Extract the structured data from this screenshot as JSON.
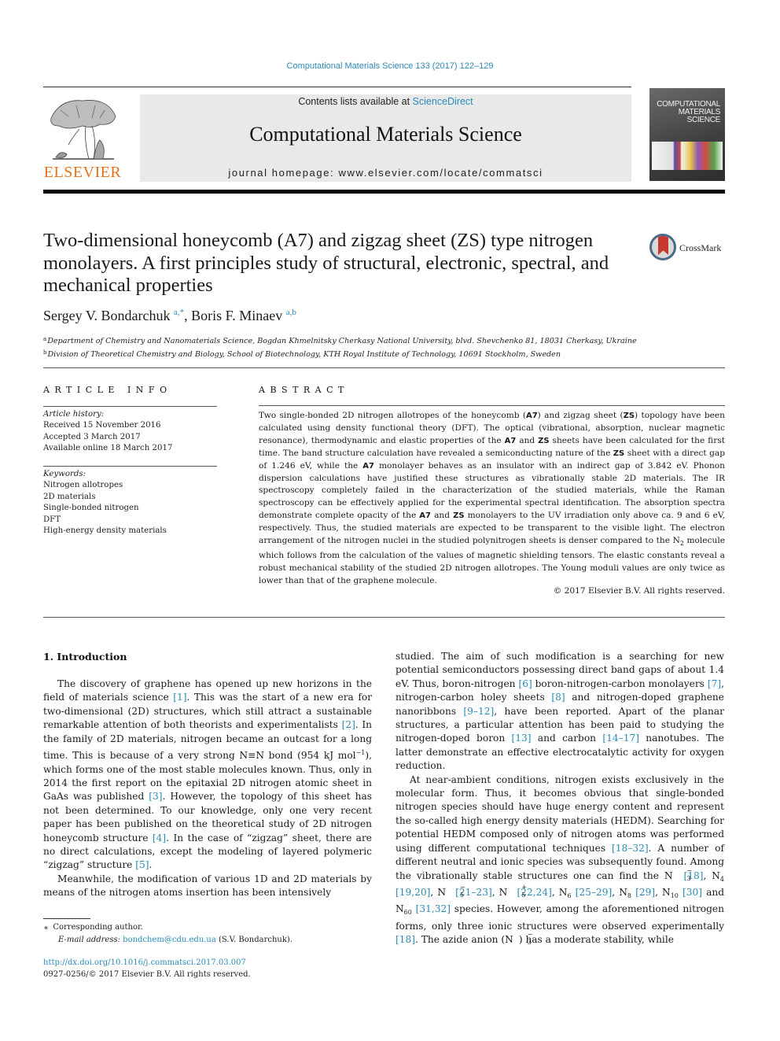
{
  "journal_citation": "Computational Materials Science 133 (2017) 122–129",
  "publisher": {
    "logo_wordmark": "ELSEVIER",
    "logo_icon": "elsevier-tree-icon"
  },
  "banner": {
    "contents_prefix": "Contents lists available at ",
    "contents_link": "ScienceDirect",
    "journal_title": "Computational Materials Science",
    "homepage_label": "journal homepage: ",
    "homepage_url": "www.elsevier.com/locate/commatsci"
  },
  "cover": {
    "title_lines": [
      "COMPUTATIONAL",
      "MATERIALS",
      "SCIENCE"
    ]
  },
  "colors": {
    "link": "#2a8ab8",
    "elsevier_orange": "#e8731a",
    "banner_bg": "#e9e9e9",
    "crossmark_red": "#c8372d"
  },
  "article": {
    "title": "Two-dimensional honeycomb (A7) and zigzag sheet (ZS) type nitrogen monolayers. A first principles study of structural, electronic, spectral, and mechanical properties",
    "crossmark_label": "CrossMark",
    "authors": [
      {
        "name": "Sergey V. Bondarchuk",
        "affil": "a,*"
      },
      {
        "name": "Boris F. Minaev",
        "affil": "a,b"
      }
    ],
    "author_separator": ", ",
    "affiliations": [
      {
        "mark": "a",
        "text": "Department of Chemistry and Nanomaterials Science, Bogdan Khmelnitsky Cherkasy National University, blvd. Shevchenko 81, 18031 Cherkasy, Ukraine"
      },
      {
        "mark": "b",
        "text": "Division of Theoretical Chemistry and Biology, School of Biotechnology, KTH Royal Institute of Technology, 10691 Stockholm, Sweden"
      }
    ]
  },
  "article_info": {
    "heading": "ARTICLE INFO",
    "history_label": "Article history:",
    "history": [
      "Received 15 November 2016",
      "Accepted 3 March 2017",
      "Available online 18 March 2017"
    ],
    "keywords_label": "Keywords:",
    "keywords": [
      "Nitrogen allotropes",
      "2D materials",
      "Single-bonded nitrogen",
      "DFT",
      "High-energy density materials"
    ]
  },
  "abstract": {
    "heading": "ABSTRACT",
    "segments": [
      {
        "t": "Two single-bonded 2D nitrogen allotropes of the honeycomb ("
      },
      {
        "t": "A7",
        "b": true
      },
      {
        "t": ") and zigzag sheet ("
      },
      {
        "t": "ZS",
        "b": true
      },
      {
        "t": ") topology have been calculated using density functional theory (DFT). The optical (vibrational, absorption, nuclear magnetic resonance), thermodynamic and elastic properties of the "
      },
      {
        "t": "A7",
        "b": true
      },
      {
        "t": " and "
      },
      {
        "t": "ZS",
        "b": true
      },
      {
        "t": " sheets have been calculated for the first time. The band structure calculation have revealed a semiconducting nature of the "
      },
      {
        "t": "ZS",
        "b": true
      },
      {
        "t": " sheet with a direct gap of 1.246 eV, while the "
      },
      {
        "t": "A7",
        "b": true
      },
      {
        "t": " monolayer behaves as an insulator with an indirect gap of 3.842 eV. Phonon dispersion calculations have justified these structures as vibrationally stable 2D materials. The IR spectroscopy completely failed in the characterization of the studied materials, while the Raman spectroscopy can be effectively applied for the experimental spectral identification. The absorption spectra demonstrate complete opacity of the "
      },
      {
        "t": "A7",
        "b": true
      },
      {
        "t": " and "
      },
      {
        "t": "ZS",
        "b": true
      },
      {
        "t": " monolayers to the UV irradiation only above ca. 9 and 6 eV, respectively. Thus, the studied materials are expected to be transparent to the visible light. The electron arrangement of the nitrogen nuclei in the studied polynitrogen sheets is denser compared to the N"
      },
      {
        "t": "2",
        "sub": true
      },
      {
        "t": " molecule which follows from the calculation of the values of magnetic shielding tensors. The elastic constants reveal a robust mechanical stability of the studied 2D nitrogen allotropes. The Young moduli values are only twice as lower than that of the graphene molecule."
      }
    ],
    "copyright": "© 2017 Elsevier B.V. All rights reserved."
  },
  "introduction": {
    "heading": "1. Introduction",
    "left_column": [
      [
        {
          "t": "The discovery of graphene has opened up new horizons in the field of materials science "
        },
        {
          "t": "[1]",
          "ref": true
        },
        {
          "t": ". This was the start of a new era for two-dimensional (2D) structures, which still attract a sustainable remarkable attention of both theorists and experimentalists "
        },
        {
          "t": "[2]",
          "ref": true
        },
        {
          "t": ". In the family of 2D materials, nitrogen became an outcast for a long time. This is because of a very strong N≡N bond (954 kJ mol"
        },
        {
          "t": "−1",
          "sup": true
        },
        {
          "t": "), which forms one of the most stable molecules known. Thus, only in 2014 the first report on the epitaxial 2D nitrogen atomic sheet in GaAs was published "
        },
        {
          "t": "[3]",
          "ref": true
        },
        {
          "t": ". However, the topology of this sheet has not been determined. To our knowledge, only one very recent paper has been published on the theoretical study of 2D nitrogen honeycomb structure "
        },
        {
          "t": "[4]",
          "ref": true
        },
        {
          "t": ". In the case of “zigzag” sheet, there are no direct calculations, except the modeling of layered polymeric “zigzag” structure "
        },
        {
          "t": "[5]",
          "ref": true
        },
        {
          "t": "."
        }
      ],
      [
        {
          "t": "Meanwhile, the modification of various 1D and 2D materials by means of the nitrogen atoms insertion has been intensively"
        }
      ]
    ],
    "right_column": [
      [
        {
          "t": "studied. The aim of such modification is a searching for new potential semiconductors possessing direct band gaps of about 1.4 eV. Thus, boron-nitrogen "
        },
        {
          "t": "[6]",
          "ref": true
        },
        {
          "t": " boron-nitrogen-carbon monolayers "
        },
        {
          "t": "[7]",
          "ref": true
        },
        {
          "t": ", nitrogen-carbon holey sheets "
        },
        {
          "t": "[8]",
          "ref": true
        },
        {
          "t": " and nitrogen-doped graphene nanoribbons "
        },
        {
          "t": "[9–12]",
          "ref": true
        },
        {
          "t": ", have been reported. Apart of the planar structures, a particular attention has been paid to studying the nitrogen-doped boron "
        },
        {
          "t": "[13]",
          "ref": true
        },
        {
          "t": " and carbon "
        },
        {
          "t": "[14–17]",
          "ref": true
        },
        {
          "t": " nanotubes. The latter demonstrate an effective electrocatalytic activity for oxygen reduction."
        }
      ],
      [
        {
          "t": "At near-ambient conditions, nitrogen exists exclusively in the molecular form. Thus, it becomes obvious that single-bonded nitrogen species should have huge energy content and represent the so-called high energy density materials (HEDM). Searching for potential HEDM composed only of nitrogen atoms was performed using different computational techniques "
        },
        {
          "t": "[18–32]",
          "ref": true
        },
        {
          "t": ". A number of different neutral and ionic species was subsequently found. Among the vibrationally stable structures one can find the N"
        },
        {
          "t": "3",
          "sub": true,
          "sup2": "−"
        },
        {
          "t": " "
        },
        {
          "t": "[18]",
          "ref": true
        },
        {
          "t": ", N"
        },
        {
          "t": "4",
          "sub": true
        },
        {
          "t": " "
        },
        {
          "t": "[19,20]",
          "ref": true
        },
        {
          "t": ", N"
        },
        {
          "t": "5",
          "sub": true,
          "sup2": "−"
        },
        {
          "t": " "
        },
        {
          "t": "[21–23]",
          "ref": true
        },
        {
          "t": ", N"
        },
        {
          "t": "5",
          "sub": true,
          "sup2": "+"
        },
        {
          "t": " "
        },
        {
          "t": "[22,24]",
          "ref": true
        },
        {
          "t": ", N"
        },
        {
          "t": "6",
          "sub": true
        },
        {
          "t": " "
        },
        {
          "t": "[25–29]",
          "ref": true
        },
        {
          "t": ", N"
        },
        {
          "t": "8",
          "sub": true
        },
        {
          "t": " "
        },
        {
          "t": "[29]",
          "ref": true
        },
        {
          "t": ", N"
        },
        {
          "t": "10",
          "sub": true
        },
        {
          "t": " "
        },
        {
          "t": "[30]",
          "ref": true
        },
        {
          "t": " and N"
        },
        {
          "t": "60",
          "sub": true
        },
        {
          "t": " "
        },
        {
          "t": "[31,32]",
          "ref": true
        },
        {
          "t": " species. However, among the aforementioned nitrogen forms, only three ionic structures were observed experimentally "
        },
        {
          "t": "[18]",
          "ref": true
        },
        {
          "t": ". The azide anion (N"
        },
        {
          "t": "3",
          "sub": true,
          "sup2": "−"
        },
        {
          "t": ") has a moderate stability, while"
        }
      ]
    ]
  },
  "footnote": {
    "marker": "⁎",
    "corresponding": "Corresponding author.",
    "email_label": "E-mail address: ",
    "email": "bondchem@cdu.edu.ua",
    "email_suffix": " (S.V. Bondarchuk)."
  },
  "doi": {
    "url": "http://dx.doi.org/10.1016/j.commatsci.2017.03.007",
    "issn_line": "0927-0256/© 2017 Elsevier B.V. All rights reserved."
  }
}
